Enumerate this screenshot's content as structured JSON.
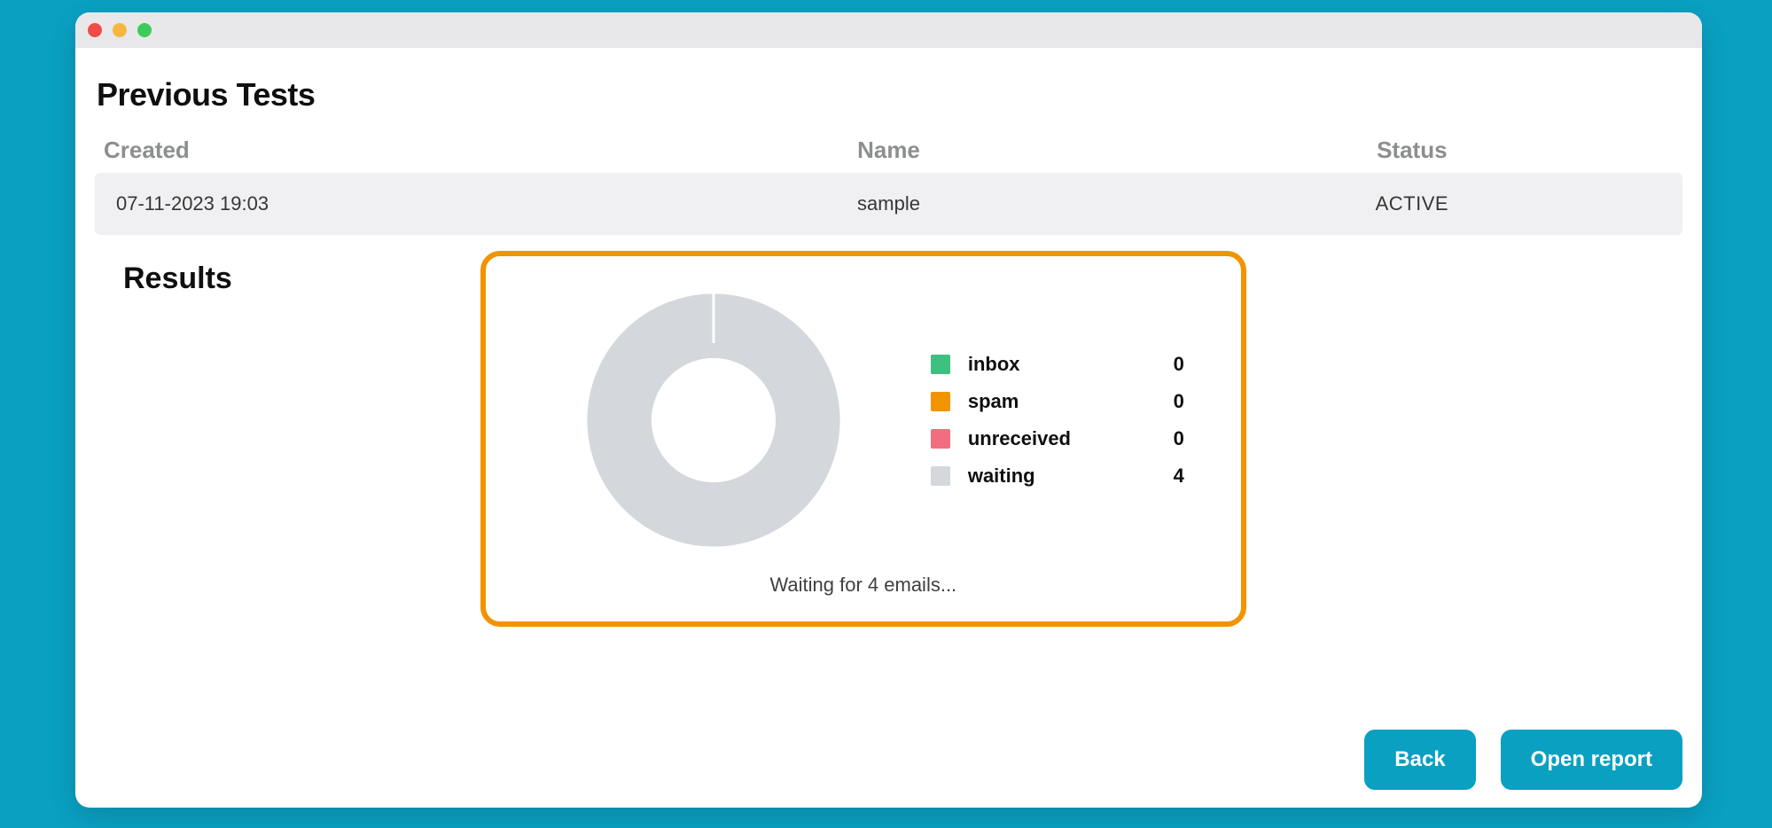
{
  "page": {
    "title": "Previous Tests"
  },
  "table": {
    "headers": {
      "created": "Created",
      "name": "Name",
      "status": "Status"
    },
    "rows": [
      {
        "created": "07-11-2023 19:03",
        "name": "sample",
        "status": "ACTIVE"
      }
    ]
  },
  "results": {
    "title": "Results",
    "wait_text": "Waiting for 4 emails...",
    "legend": {
      "inbox": {
        "label": "inbox",
        "value": 0,
        "color": "#3ec07e"
      },
      "spam": {
        "label": "spam",
        "value": 0,
        "color": "#f29300"
      },
      "unreceived": {
        "label": "unreceived",
        "value": 0,
        "color": "#f06e7f"
      },
      "waiting": {
        "label": "waiting",
        "value": 4,
        "color": "#d4d8dc"
      }
    }
  },
  "actions": {
    "back": "Back",
    "open_report": "Open report"
  },
  "chart_data": {
    "type": "pie",
    "title": "",
    "series": [
      {
        "name": "inbox",
        "value": 0,
        "color": "#3ec07e"
      },
      {
        "name": "spam",
        "value": 0,
        "color": "#f29300"
      },
      {
        "name": "unreceived",
        "value": 0,
        "color": "#f06e7f"
      },
      {
        "name": "waiting",
        "value": 4,
        "color": "#d4d8dc"
      }
    ],
    "donut": true,
    "inner_radius_ratio": 0.48,
    "note": "Waiting for 4 emails..."
  }
}
